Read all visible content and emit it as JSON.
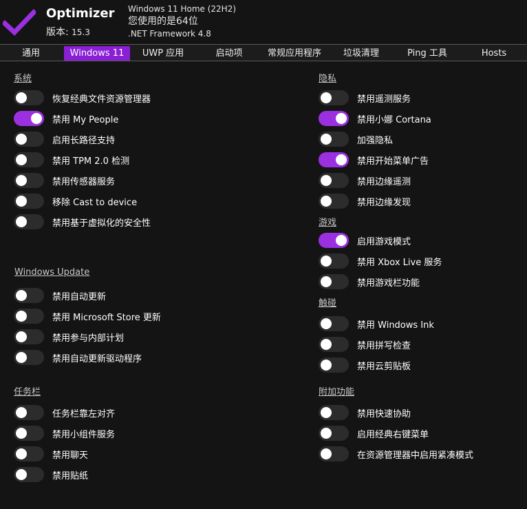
{
  "app": {
    "name": "Optimizer",
    "version_label": "版本:",
    "version_number": "15.3",
    "os_name": "Windows 11 Home (22H2)",
    "arch_text": "您使用的是64位",
    "framework": ".NET Framework 4.8",
    "logo_icon": "checkmark-icon",
    "accent_color": "#9b30e0"
  },
  "tabs": [
    "通用",
    "Windows 11",
    "UWP 应用",
    "启动项",
    "常规应用程序",
    "垃圾清理",
    "Ping 工具",
    "Hosts"
  ],
  "active_tab": "Windows 11",
  "sections": {
    "system": {
      "title": "系统",
      "items": [
        {
          "label": "恢复经典文件资源管理器",
          "on": false
        },
        {
          "label": "禁用 My People",
          "on": true
        },
        {
          "label": "启用长路径支持",
          "on": false
        },
        {
          "label": "禁用 TPM 2.0 检测",
          "on": false
        },
        {
          "label": "禁用传感器服务",
          "on": false
        },
        {
          "label": "移除 Cast to device",
          "on": false
        },
        {
          "label": "禁用基于虚拟化的安全性",
          "on": false
        }
      ]
    },
    "update": {
      "title": "Windows Update",
      "items": [
        {
          "label": "禁用自动更新",
          "on": false
        },
        {
          "label": "禁用 Microsoft Store 更新",
          "on": false
        },
        {
          "label": "禁用参与内部计划",
          "on": false
        },
        {
          "label": "禁用自动更新驱动程序",
          "on": false
        }
      ]
    },
    "taskbar": {
      "title": "任务栏",
      "items": [
        {
          "label": "任务栏靠左对齐",
          "on": false
        },
        {
          "label": "禁用小组件服务",
          "on": false
        },
        {
          "label": "禁用聊天",
          "on": false
        },
        {
          "label": "禁用贴纸",
          "on": false
        }
      ]
    },
    "privacy": {
      "title": "隐私",
      "items": [
        {
          "label": "禁用遥测服务",
          "on": false
        },
        {
          "label": "禁用小娜 Cortana",
          "on": true
        },
        {
          "label": "加强隐私",
          "on": false
        },
        {
          "label": "禁用开始菜单广告",
          "on": true
        },
        {
          "label": "禁用边缘遥测",
          "on": false
        },
        {
          "label": "禁用边缘发现",
          "on": false
        }
      ]
    },
    "gaming": {
      "title": "游戏",
      "items": [
        {
          "label": "启用游戏模式",
          "on": true
        },
        {
          "label": "禁用 Xbox Live 服务",
          "on": false
        },
        {
          "label": "禁用游戏栏功能",
          "on": false
        }
      ]
    },
    "touch": {
      "title": "触碰",
      "items": [
        {
          "label": "禁用 Windows Ink",
          "on": false
        },
        {
          "label": "禁用拼写检查",
          "on": false
        },
        {
          "label": "禁用云剪贴板",
          "on": false
        }
      ]
    },
    "extras": {
      "title": "附加功能",
      "items": [
        {
          "label": "禁用快速协助",
          "on": false
        },
        {
          "label": "启用经典右键菜单",
          "on": false
        },
        {
          "label": "在资源管理器中启用紧凑模式",
          "on": false
        }
      ]
    }
  }
}
